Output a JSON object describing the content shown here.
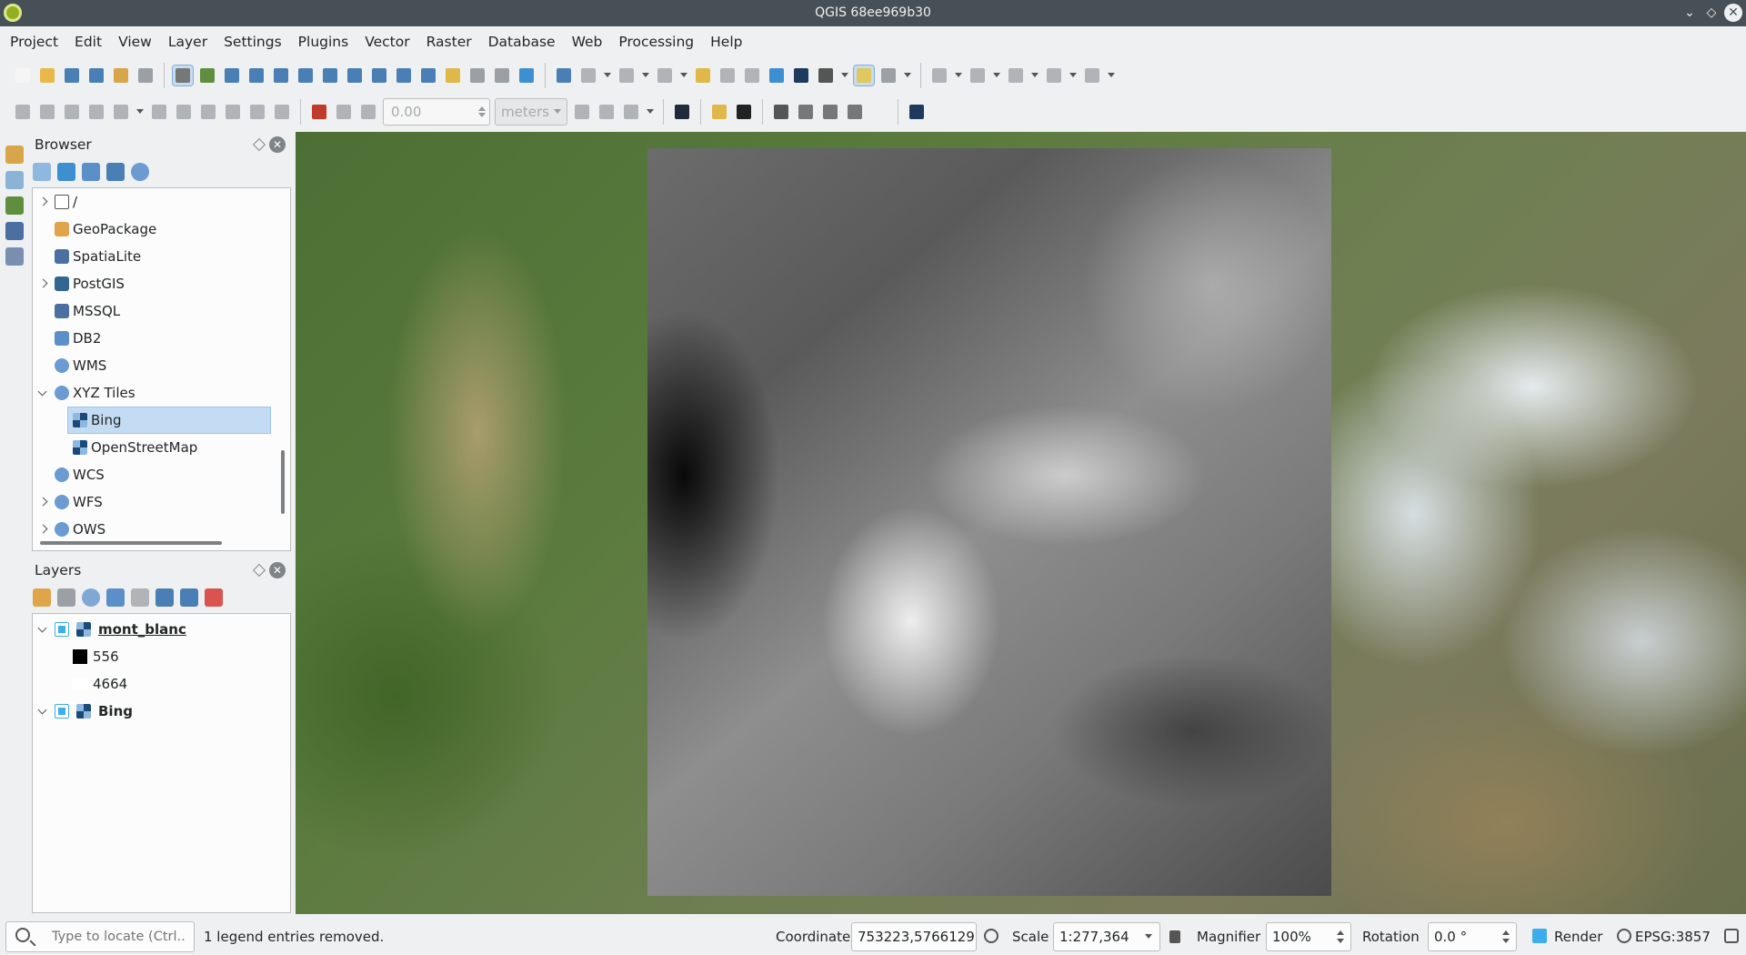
{
  "window": {
    "title": "QGIS 68ee969b30"
  },
  "menu": [
    "Project",
    "Edit",
    "View",
    "Layer",
    "Settings",
    "Plugins",
    "Vector",
    "Raster",
    "Database",
    "Web",
    "Processing",
    "Help"
  ],
  "toolbar2": {
    "value_field": "0.00",
    "units_combo": "meters"
  },
  "browser": {
    "title": "Browser",
    "items": [
      {
        "label": "/",
        "icon": "folder-icon",
        "expander": "closed",
        "indent": 0
      },
      {
        "label": "GeoPackage",
        "icon": "geopackage-icon",
        "expander": "",
        "indent": 0
      },
      {
        "label": "SpatiaLite",
        "icon": "spatialite-icon",
        "expander": "",
        "indent": 0
      },
      {
        "label": "PostGIS",
        "icon": "postgis-icon",
        "expander": "closed",
        "indent": 0
      },
      {
        "label": "MSSQL",
        "icon": "mssql-icon",
        "expander": "",
        "indent": 0
      },
      {
        "label": "DB2",
        "icon": "db2-icon",
        "expander": "",
        "indent": 0
      },
      {
        "label": "WMS",
        "icon": "globe-icon",
        "expander": "",
        "indent": 0
      },
      {
        "label": "XYZ Tiles",
        "icon": "globe-icon",
        "expander": "open",
        "indent": 0
      },
      {
        "label": "Bing",
        "icon": "raster-tile-icon",
        "expander": "",
        "indent": 1,
        "selected": true
      },
      {
        "label": "OpenStreetMap",
        "icon": "raster-tile-icon",
        "expander": "",
        "indent": 1
      },
      {
        "label": "WCS",
        "icon": "globe-icon",
        "expander": "",
        "indent": 0
      },
      {
        "label": "WFS",
        "icon": "globe-icon",
        "expander": "closed",
        "indent": 0
      },
      {
        "label": "OWS",
        "icon": "globe-icon",
        "expander": "closed",
        "indent": 0
      }
    ]
  },
  "layers": {
    "title": "Layers",
    "layer1": {
      "name": "mont_blanc",
      "legend_min": "556",
      "legend_max": "4664"
    },
    "layer2": {
      "name": "Bing"
    }
  },
  "status": {
    "locator_placeholder": "Type to locate (Ctrl...",
    "message": "1 legend entries removed.",
    "coordinate_label": "Coordinate",
    "coordinate_value": "753223,5766129",
    "scale_label": "Scale",
    "scale_value": "1:277,364",
    "magnifier_label": "Magnifier",
    "magnifier_value": "100%",
    "rotation_label": "Rotation",
    "rotation_value": "0.0 °",
    "render_label": "Render",
    "crs": "EPSG:3857"
  }
}
